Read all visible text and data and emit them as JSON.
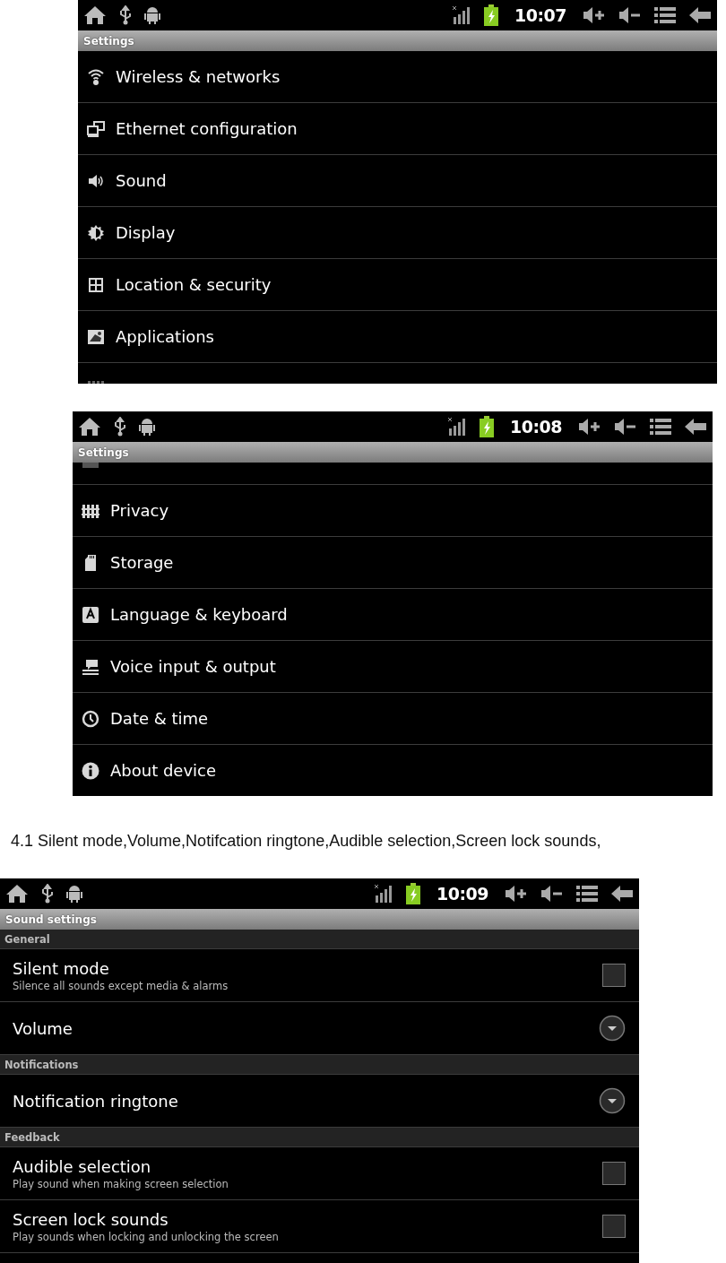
{
  "settings_screens": [
    {
      "status_bar": {
        "time": "10:07"
      },
      "title": "Settings",
      "items": [
        {
          "label": "Wireless & networks"
        },
        {
          "label": "Ethernet configuration"
        },
        {
          "label": "Sound"
        },
        {
          "label": "Display"
        },
        {
          "label": "Location & security"
        },
        {
          "label": "Applications"
        },
        {
          "kind": "cut_off"
        }
      ]
    },
    {
      "status_bar": {
        "time": "10:08"
      },
      "title": "Settings",
      "items": [
        {
          "kind": "cut_off"
        },
        {
          "label": "Privacy"
        },
        {
          "label": "Storage"
        },
        {
          "label": "Language & keyboard"
        },
        {
          "label": "Voice input & output"
        },
        {
          "label": "Date & time"
        },
        {
          "label": "About device"
        }
      ]
    }
  ],
  "caption": "4.1 Silent mode,Volume,Notifcation ringtone,Audible selection,Screen lock sounds,",
  "sound_screen": {
    "status_bar": {
      "time": "10:09"
    },
    "title": "Sound settings",
    "sections": [
      {
        "header": "General",
        "items": [
          {
            "kind": "checkbox",
            "title": "Silent mode",
            "summary": "Silence all sounds except media & alarms",
            "checked": false
          },
          {
            "kind": "menu",
            "title": "Volume"
          }
        ]
      },
      {
        "header": "Notifications",
        "items": [
          {
            "kind": "menu",
            "title": "Notification ringtone"
          }
        ]
      },
      {
        "header": "Feedback",
        "items": [
          {
            "kind": "checkbox",
            "title": "Audible selection",
            "summary": "Play sound when making screen selection",
            "checked": false
          },
          {
            "kind": "checkbox",
            "title": "Screen lock sounds",
            "summary": "Play sounds when locking and unlocking the screen",
            "checked": false
          }
        ]
      }
    ]
  }
}
